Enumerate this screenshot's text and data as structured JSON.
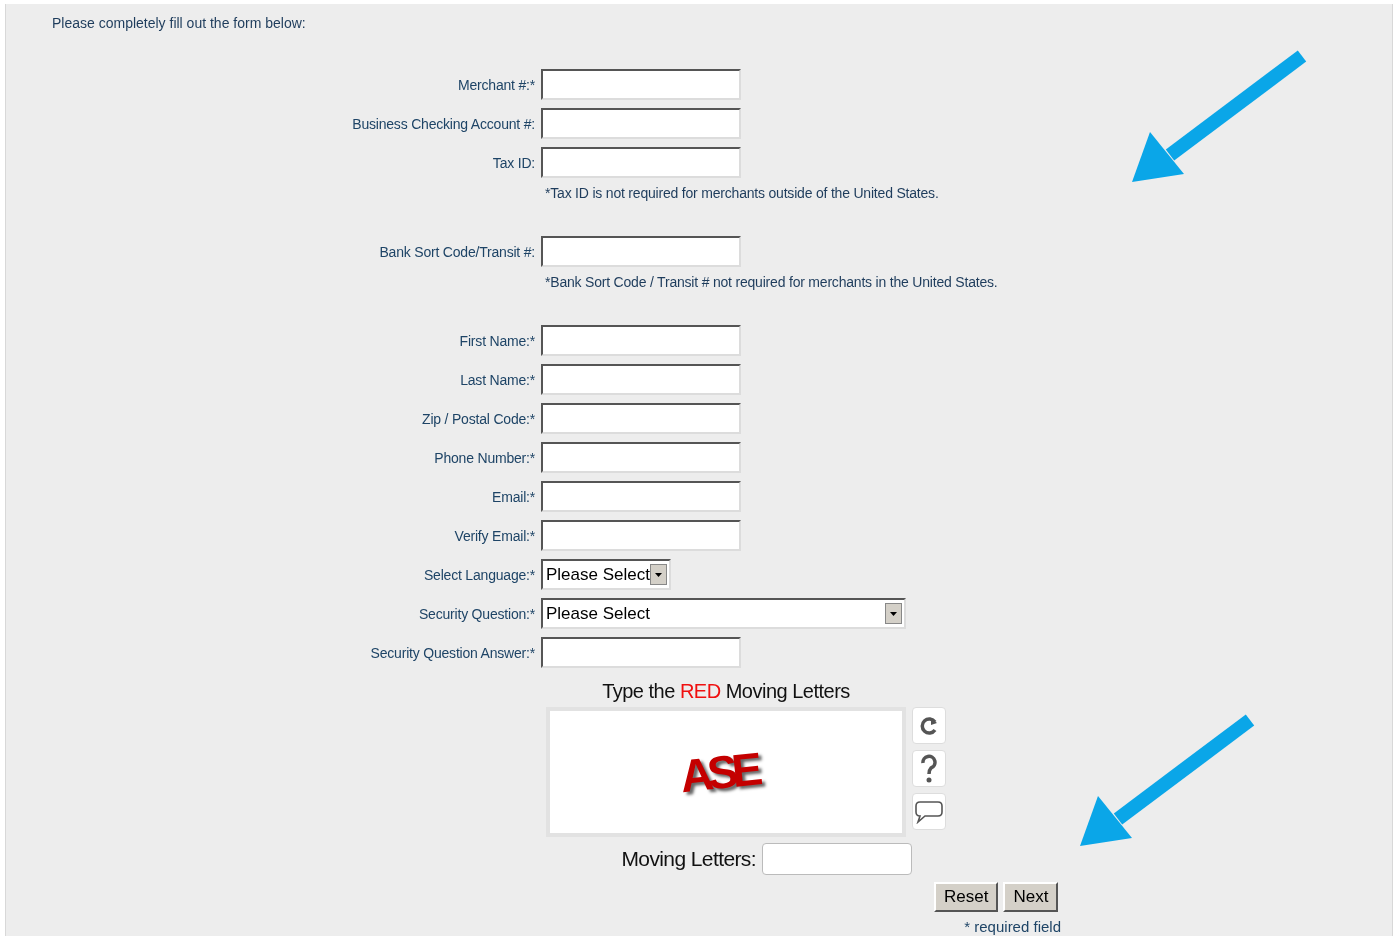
{
  "intro": "Please completely fill out the form below:",
  "rows": [
    {
      "kind": "text",
      "label": "Merchant #:*"
    },
    {
      "kind": "text",
      "label": "Business Checking Account #:"
    },
    {
      "kind": "text",
      "label": "Tax ID:"
    },
    {
      "kind": "note",
      "text": "*Tax ID is not required for merchants outside of the United States."
    },
    {
      "kind": "text",
      "label": "Bank Sort Code/Transit #:"
    },
    {
      "kind": "note",
      "text": "*Bank Sort Code / Transit # not required for merchants in the United States."
    },
    {
      "kind": "text",
      "label": "First Name:*"
    },
    {
      "kind": "text",
      "label": "Last Name:*"
    },
    {
      "kind": "text",
      "label": "Zip / Postal Code:*"
    },
    {
      "kind": "text",
      "label": "Phone Number:*"
    },
    {
      "kind": "text",
      "label": "Email:*"
    },
    {
      "kind": "text",
      "label": "Verify Email:*"
    },
    {
      "kind": "select",
      "label": "Select Language:*",
      "value": "Please Select"
    },
    {
      "kind": "select",
      "label": "Security Question:*",
      "value": "Please Select"
    },
    {
      "kind": "text",
      "label": "Security Question Answer:*"
    }
  ],
  "captcha": {
    "heading_before": "Type the",
    "heading_highlight": "RED",
    "heading_after": "Moving Letters",
    "letters": "ASE",
    "answer_label": "Moving Letters:"
  },
  "buttons": [
    "Reset",
    "Next"
  ],
  "footnote": "* required field"
}
